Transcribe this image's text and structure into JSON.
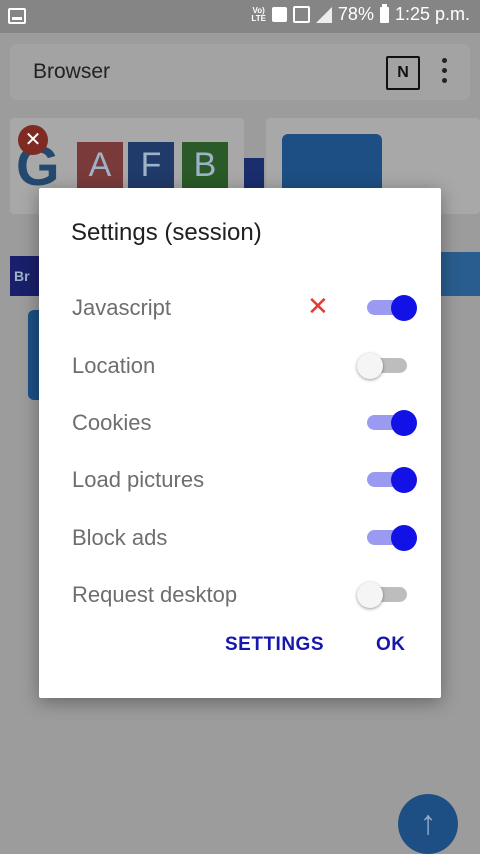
{
  "status_bar": {
    "network": "LTE",
    "battery": "78%",
    "time": "1:25 p.m."
  },
  "toolbar": {
    "title": "Browser",
    "tab_button": "N"
  },
  "background": {
    "tiles": [
      "A",
      "F",
      "B"
    ],
    "logo_letter": "G",
    "close_symbol": "✕",
    "left_stripe": "Br"
  },
  "dialog": {
    "title": "Settings (session)",
    "rows": [
      {
        "label": "Javascript",
        "enabled": true,
        "has_clear": true
      },
      {
        "label": "Location",
        "enabled": false
      },
      {
        "label": "Cookies",
        "enabled": true
      },
      {
        "label": "Load pictures",
        "enabled": true
      },
      {
        "label": "Block ads",
        "enabled": true
      },
      {
        "label": "Request desktop",
        "enabled": false
      }
    ],
    "clear_symbol": "✕",
    "buttons": {
      "settings": "SETTINGS",
      "ok": "OK"
    }
  },
  "fab": {
    "icon": "arrow-up-icon",
    "symbol": "↑"
  },
  "colors": {
    "accent": "#1212e6",
    "button_text": "#1616b0",
    "clear_icon": "#e53935"
  }
}
